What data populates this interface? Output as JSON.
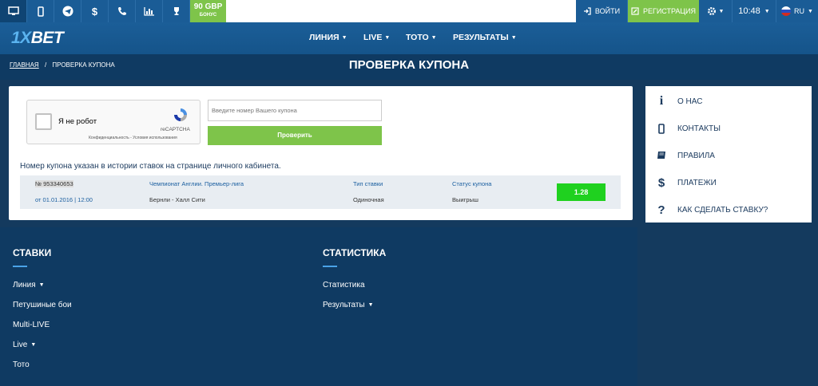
{
  "topbar": {
    "icons": [
      "desktop-icon",
      "mobile-icon",
      "telegram-icon",
      "dollar-icon",
      "phone-icon",
      "chart-icon",
      "trophy-icon"
    ],
    "bonus_amount": "90 GBP",
    "bonus_label": "БОНУС",
    "login_label": "ВОЙТИ",
    "register_label": "РЕГИСТРАЦИЯ",
    "time": "10:48",
    "lang": "RU"
  },
  "header": {
    "logo_num": "1X",
    "logo_text": "BET",
    "nav": [
      "ЛИНИЯ",
      "LIVE",
      "ТОТО",
      "РЕЗУЛЬТАТЫ"
    ]
  },
  "breadcrumb": {
    "home": "ГЛАВНАЯ",
    "sep": "/",
    "current": "ПРОВЕРКА КУПОНА"
  },
  "page_title": "ПРОВЕРКА КУПОНА",
  "captcha": {
    "label": "Я не робот",
    "brand": "reCAPTCHA",
    "privacy": "Конфиденциальность - Условия использования"
  },
  "coupon_input": {
    "placeholder": "Введите номер Вашего купона"
  },
  "check_button": "Проверить",
  "note": "Номер купона указан в истории ставок на странице личного кабинета.",
  "coupon": {
    "number": "№ 953340653",
    "date": "от 01.01.2016 | 12:00",
    "league": "Чемпионат Англии. Премьер-лига",
    "match": "Бернли - Халл Сити",
    "type_label": "Тип ставки",
    "type_value": "Одиночная",
    "status_label": "Статус купона",
    "status_value": "Выигрыш",
    "odds": "1.28"
  },
  "sidebar": [
    {
      "icon": "info-icon",
      "glyph": "i",
      "label": "О НАС"
    },
    {
      "icon": "mobile-icon",
      "glyph": "▯",
      "label": "КОНТАКТЫ"
    },
    {
      "icon": "book-icon",
      "glyph": "▰",
      "label": "ПРАВИЛА"
    },
    {
      "icon": "dollar-icon",
      "glyph": "$",
      "label": "ПЛАТЕЖИ"
    },
    {
      "icon": "question-icon",
      "glyph": "?",
      "label": "КАК СДЕЛАТЬ СТАВКУ?"
    }
  ],
  "footer": {
    "bets": {
      "title": "СТАВКИ",
      "links": [
        "Линия",
        "Петушиные бои",
        "Multi-LIVE",
        "Live",
        "Тото"
      ]
    },
    "stats": {
      "title": "СТАТИСТИКА",
      "links": [
        "Статистика",
        "Результаты"
      ]
    }
  },
  "colors": {
    "brand_blue": "#1a5c96",
    "green": "#7ec44a",
    "odds_green": "#1fd11f",
    "dark": "#0f3a62"
  }
}
